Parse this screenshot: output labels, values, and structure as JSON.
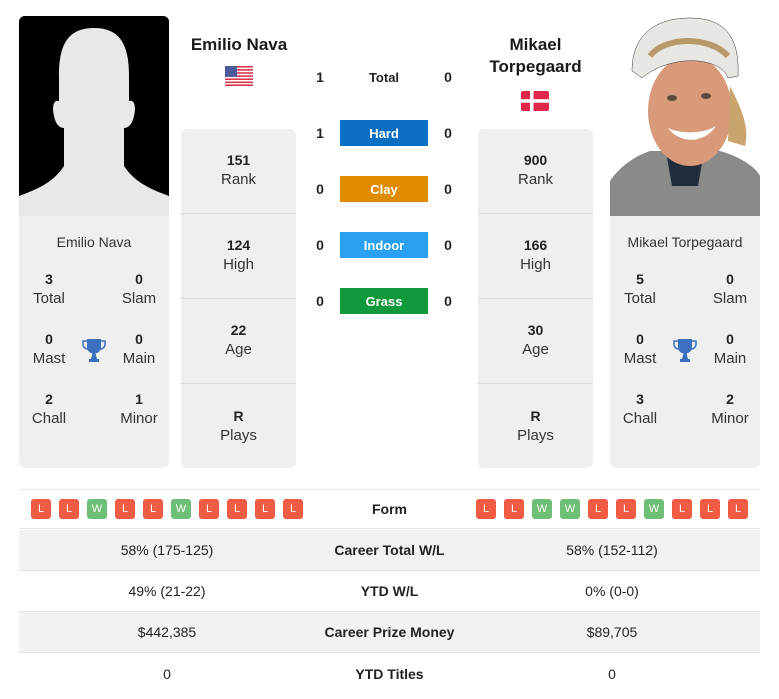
{
  "player1": {
    "name": "Emilio Nava",
    "country_flag": "usa-flag",
    "photo": "silhouette-placeholder",
    "stats": [
      {
        "value": "151",
        "label": "Rank"
      },
      {
        "value": "124",
        "label": "High"
      },
      {
        "value": "22",
        "label": "Age"
      },
      {
        "value": "R",
        "label": "Plays"
      }
    ],
    "titles": {
      "total": {
        "value": "3",
        "label": "Total"
      },
      "slam": {
        "value": "0",
        "label": "Slam"
      },
      "mast": {
        "value": "0",
        "label": "Mast"
      },
      "main": {
        "value": "0",
        "label": "Main"
      },
      "chall": {
        "value": "2",
        "label": "Chall"
      },
      "minor": {
        "value": "1",
        "label": "Minor"
      }
    },
    "form": [
      "L",
      "L",
      "W",
      "L",
      "L",
      "W",
      "L",
      "L",
      "L",
      "L"
    ]
  },
  "player2": {
    "name": "Mikael Torpegaard",
    "name_line1": "Mikael",
    "name_line2": "Torpegaard",
    "country_flag": "denmark-flag",
    "photo": "player-headshot",
    "stats": [
      {
        "value": "900",
        "label": "Rank"
      },
      {
        "value": "166",
        "label": "High"
      },
      {
        "value": "30",
        "label": "Age"
      },
      {
        "value": "R",
        "label": "Plays"
      }
    ],
    "titles": {
      "total": {
        "value": "5",
        "label": "Total"
      },
      "slam": {
        "value": "0",
        "label": "Slam"
      },
      "mast": {
        "value": "0",
        "label": "Mast"
      },
      "main": {
        "value": "0",
        "label": "Main"
      },
      "chall": {
        "value": "3",
        "label": "Chall"
      },
      "minor": {
        "value": "2",
        "label": "Minor"
      }
    },
    "form": [
      "L",
      "L",
      "W",
      "W",
      "L",
      "L",
      "W",
      "L",
      "L",
      "L"
    ]
  },
  "h2h": [
    {
      "label": "Total",
      "p1": "1",
      "p2": "0",
      "color": null
    },
    {
      "label": "Hard",
      "p1": "1",
      "p2": "0",
      "color": "#0a6fc2"
    },
    {
      "label": "Clay",
      "p1": "0",
      "p2": "0",
      "color": "#e08c00"
    },
    {
      "label": "Indoor",
      "p1": "0",
      "p2": "0",
      "color": "#2aa0f2"
    },
    {
      "label": "Grass",
      "p1": "0",
      "p2": "0",
      "color": "#109a3c"
    }
  ],
  "form_label": "Form",
  "comparison": [
    {
      "label": "Career Total W/L",
      "p1": "58% (175-125)",
      "p2": "58% (152-112)"
    },
    {
      "label": "YTD W/L",
      "p1": "49% (21-22)",
      "p2": "0% (0-0)"
    },
    {
      "label": "Career Prize Money",
      "p1": "$442,385",
      "p2": "$89,705"
    },
    {
      "label": "YTD Titles",
      "p1": "0",
      "p2": "0"
    }
  ],
  "colors": {
    "loss": "#ef5b43",
    "win": "#6cbf74",
    "trophy": "#3b6fc0"
  }
}
